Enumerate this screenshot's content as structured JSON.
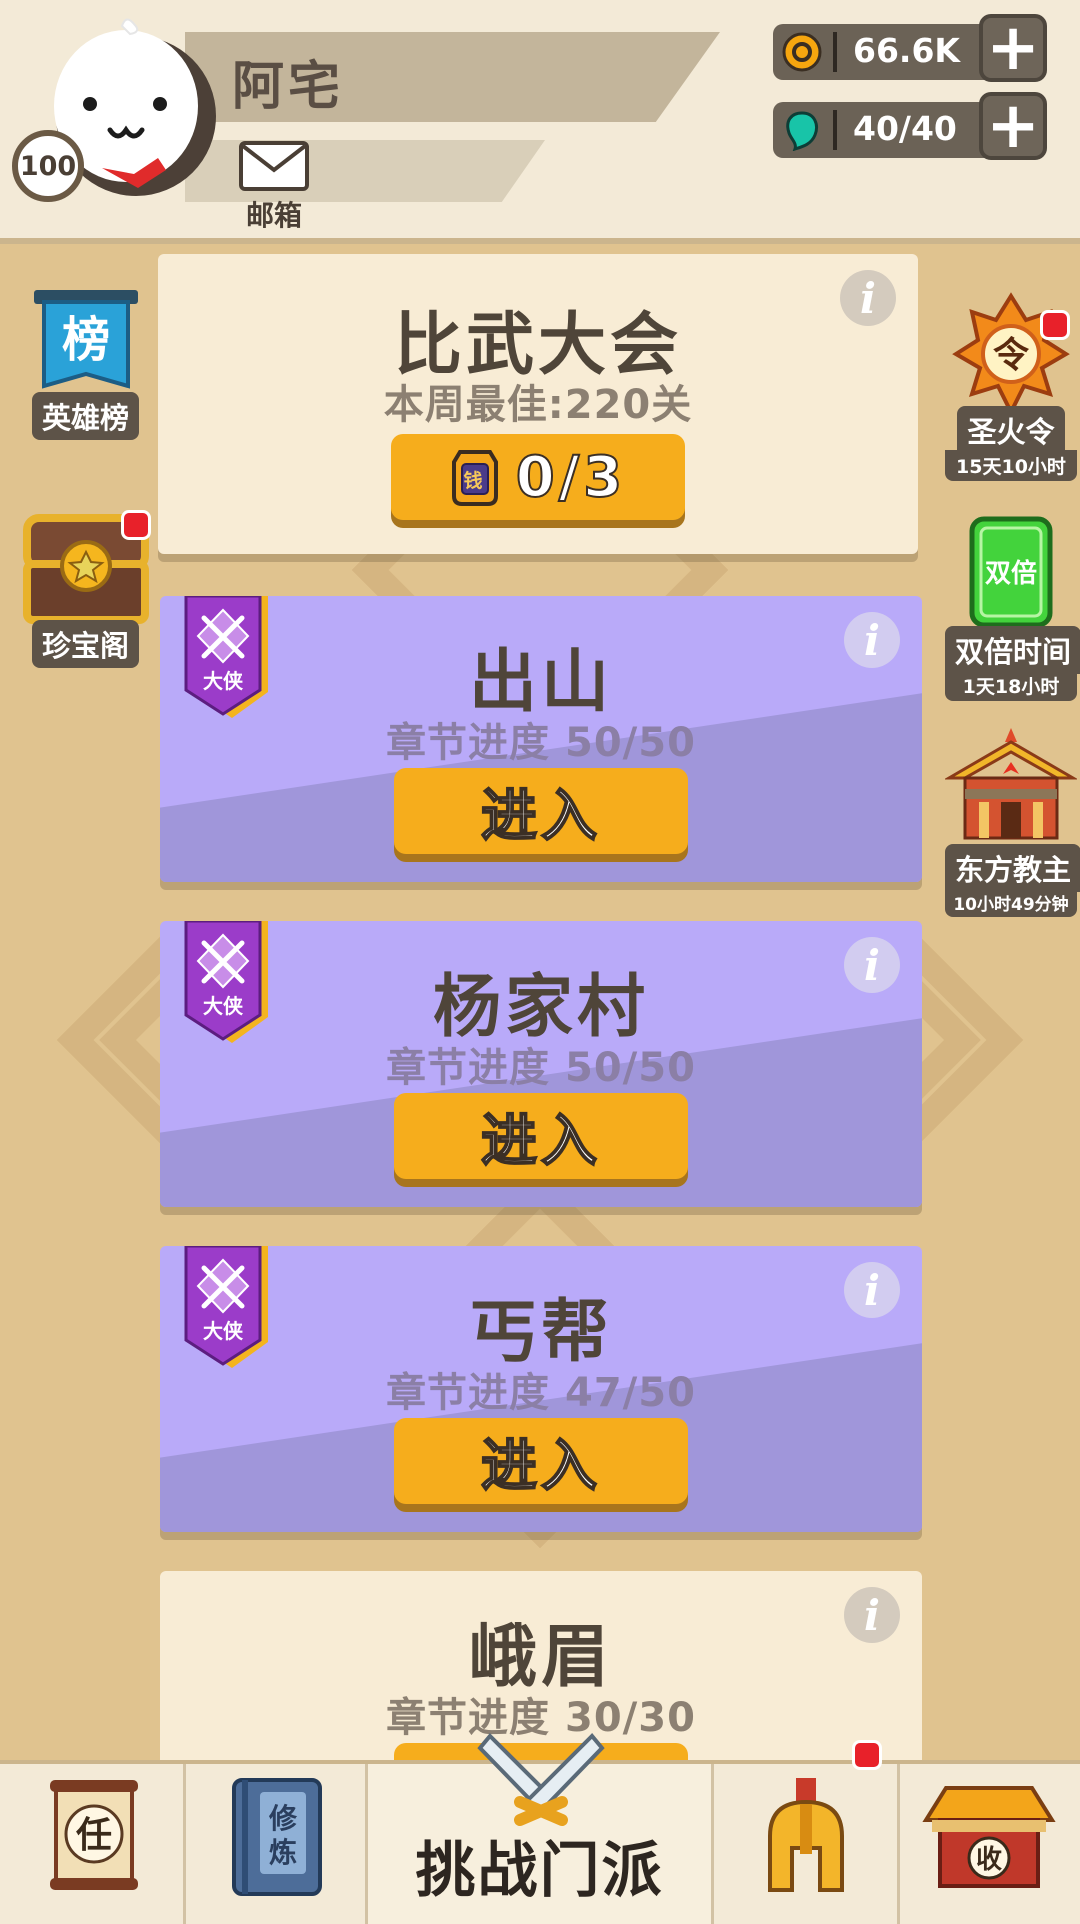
{
  "header": {
    "player_name": "阿宅",
    "level": "100",
    "mail_label": "邮箱",
    "resources": [
      {
        "icon": "coin-icon",
        "value": "66.6K"
      },
      {
        "icon": "jade-icon",
        "value": "40/40"
      }
    ]
  },
  "left_sidebar": [
    {
      "icon": "leaderboard-banner-icon",
      "banner_char": "榜",
      "label": "英雄榜"
    },
    {
      "icon": "treasure-chest-icon",
      "label": "珍宝阁",
      "notify": true
    }
  ],
  "right_sidebar": [
    {
      "icon": "holy-fire-token-icon",
      "emblem_char": "令",
      "label": "圣火令",
      "timer": "15天10小时",
      "notify": true
    },
    {
      "icon": "double-card-icon",
      "card_text": "双倍",
      "label": "双倍时间",
      "timer": "1天18小时"
    },
    {
      "icon": "pagoda-icon",
      "label": "东方教主",
      "timer": "10小时49分钟"
    }
  ],
  "cards": [
    {
      "title": "比武大会",
      "subtitle": "本周最佳:220关",
      "button": "0/3",
      "button_icon_char": "钱"
    },
    {
      "title": "出山",
      "subtitle": "章节进度 50/50",
      "button": "进入",
      "badge": "大侠"
    },
    {
      "title": "杨家村",
      "subtitle": "章节进度 50/50",
      "button": "进入",
      "badge": "大侠"
    },
    {
      "title": "丐帮",
      "subtitle": "章节进度 47/50",
      "button": "进入",
      "badge": "大侠"
    },
    {
      "title": "峨眉",
      "subtitle": "章节进度 30/30"
    }
  ],
  "bottom_nav": {
    "tabs": [
      {
        "icon": "task-scroll-icon",
        "char": "任"
      },
      {
        "icon": "cultivation-book-icon",
        "chars": [
          "修",
          "炼"
        ]
      },
      {
        "icon": "crossed-swords-icon",
        "label": "挑战门派"
      },
      {
        "icon": "helmet-icon",
        "notify": true
      },
      {
        "icon": "shop-building-icon",
        "char": "收"
      }
    ]
  },
  "colors": {
    "background": "#e0c38f",
    "card_cream": "#f8ecd5",
    "card_purple": "#b9aaf9",
    "button_orange": "#f6ad1c",
    "notify_red": "#e8212a"
  }
}
